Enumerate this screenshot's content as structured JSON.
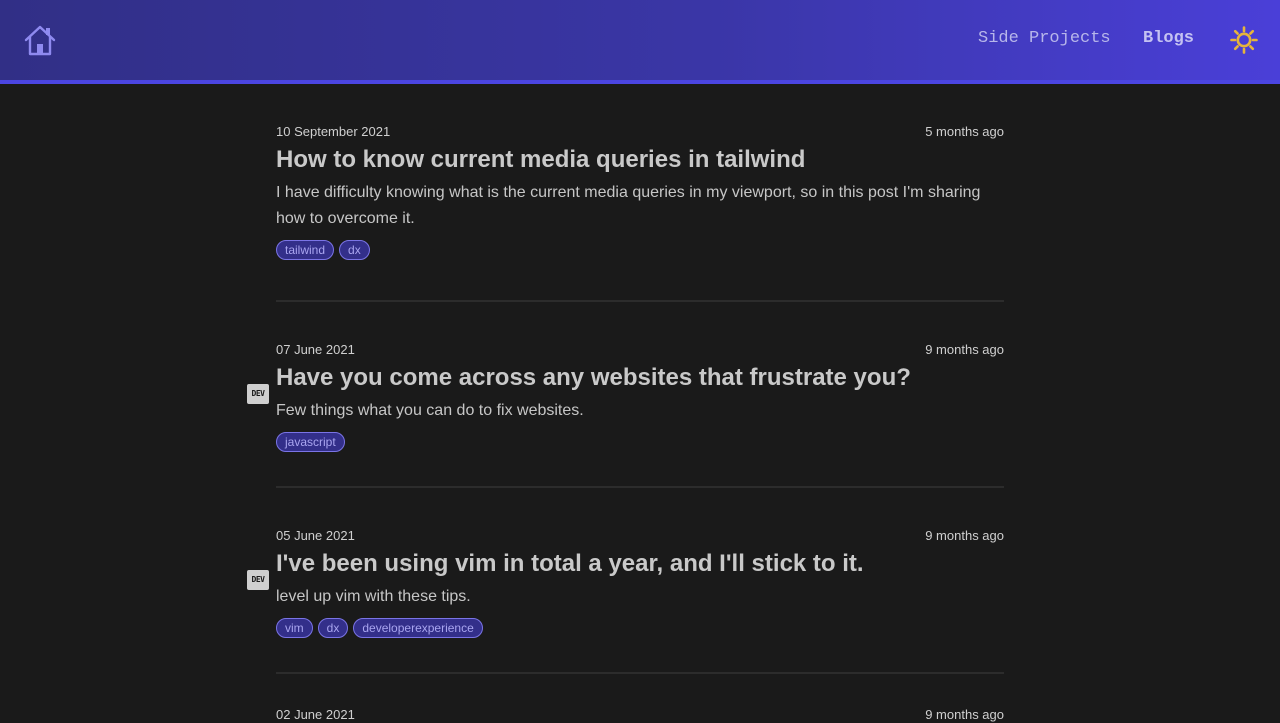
{
  "nav": {
    "side_projects": "Side Projects",
    "blogs": "Blogs"
  },
  "icons": {
    "home": "home-icon",
    "theme": "sun-icon",
    "dev": "dev-icon"
  },
  "colors": {
    "header_start": "#312f86",
    "header_end": "#4a3fd8",
    "accent": "#4b45e2",
    "sun": "#e6b43c",
    "background": "#1a1a1a"
  },
  "posts": [
    {
      "date": "10 September 2021",
      "ago": "5 months ago",
      "title": "How to know current media queries in tailwind",
      "desc": "I have difficulty knowing what is the current media queries in my viewport, so in this post I'm sharing how to overcome it.",
      "dev": false,
      "tags": [
        "tailwind",
        "dx"
      ]
    },
    {
      "date": "07 June 2021",
      "ago": "9 months ago",
      "title": "Have you come across any websites that frustrate you?",
      "desc": "Few things what you can do to fix websites.",
      "dev": true,
      "dev_label": "DEV",
      "tags": [
        "javascript"
      ]
    },
    {
      "date": "05 June 2021",
      "ago": "9 months ago",
      "title": "I've been using vim in total a year, and I'll stick to it.",
      "desc": "level up vim with these tips.",
      "dev": true,
      "dev_label": "DEV",
      "tags": [
        "vim",
        "dx",
        "developerexperience"
      ]
    },
    {
      "date": "02 June 2021",
      "ago": "9 months ago"
    }
  ]
}
